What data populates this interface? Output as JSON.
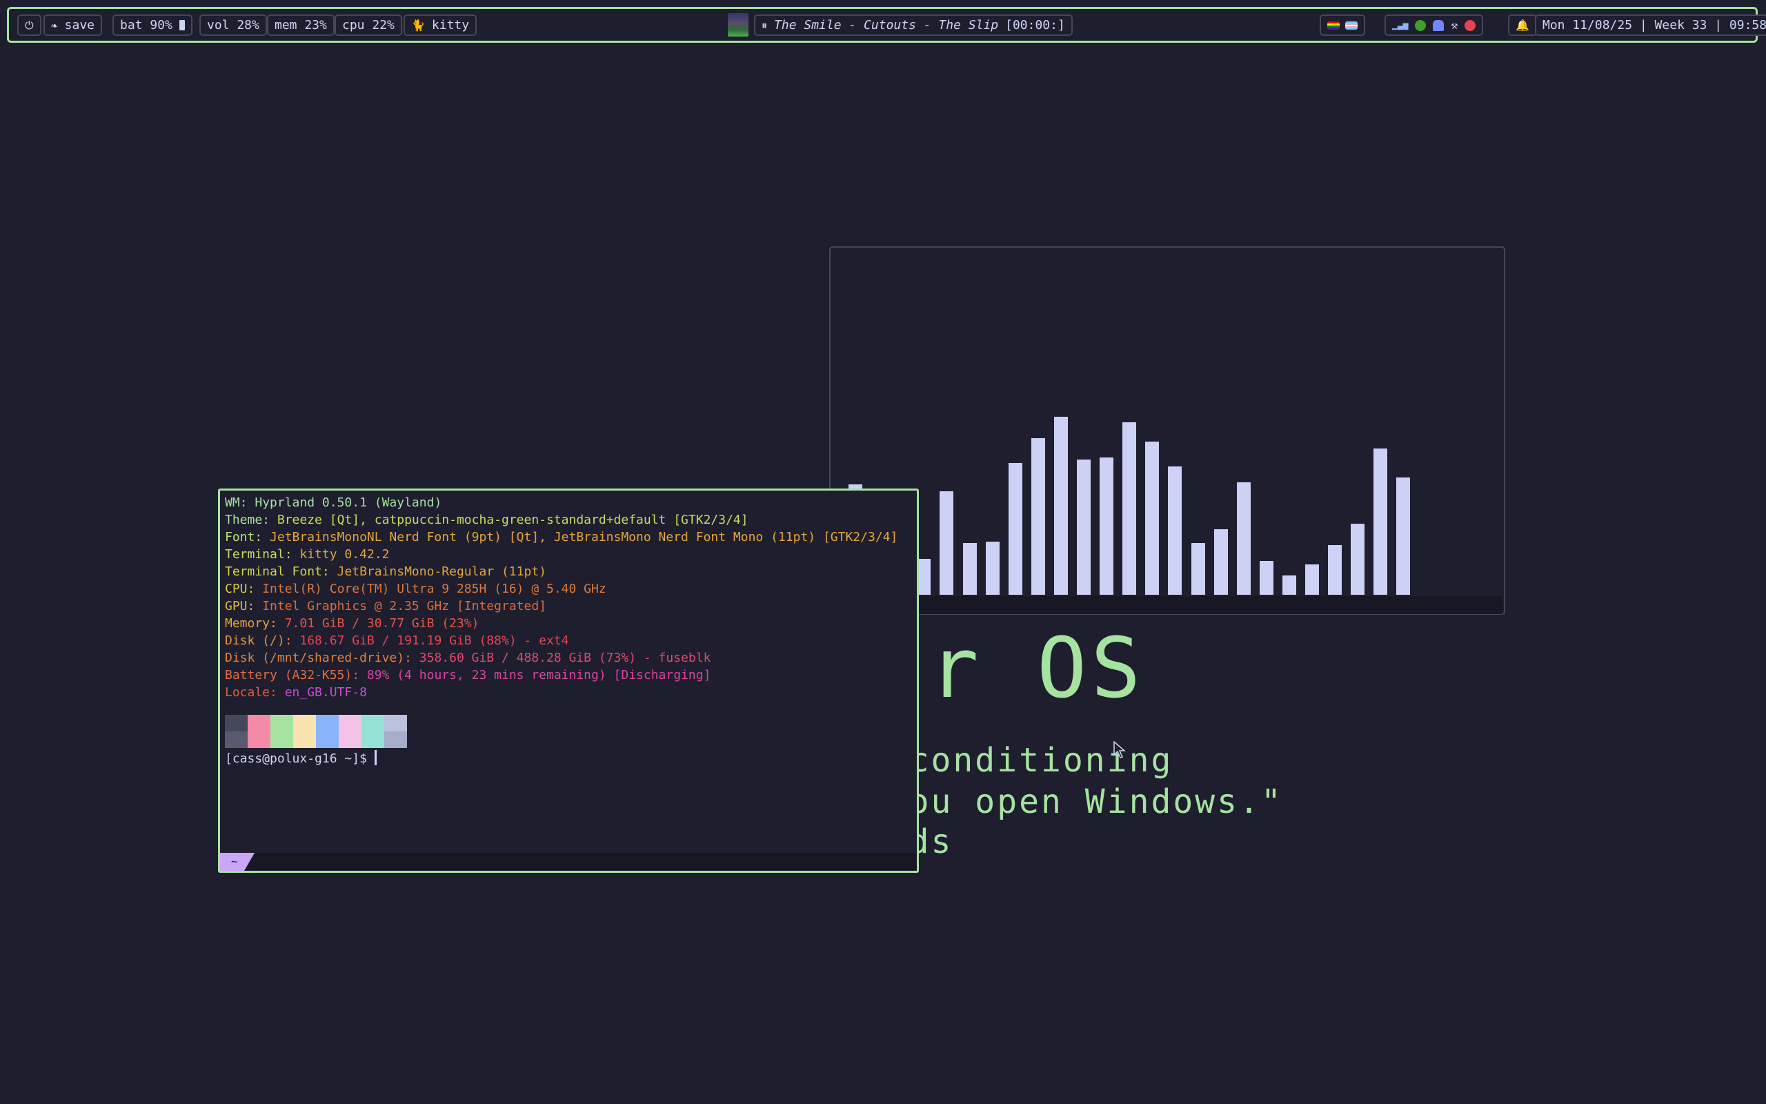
{
  "topbar": {
    "power_icon": "power-icon",
    "save_label": "save",
    "battery_label": "bat 90%",
    "volume_label": "vol 28%",
    "memory_label": "mem 23%",
    "cpu_label": "cpu 22%",
    "active_window_label": "kitty",
    "media": {
      "title": "The Smile - Cutouts - The Slip",
      "time": "[00:00:]"
    },
    "datetime": "Mon 11/08/25 | Week 33 | 09:58"
  },
  "visualizer": {
    "bar_levels": [
      0.62,
      0.28,
      0.16,
      0.2,
      0.58,
      0.29,
      0.3,
      0.74,
      0.88,
      1.0,
      0.76,
      0.77,
      0.97,
      0.86,
      0.72,
      0.29,
      0.37,
      0.63,
      0.19,
      0.11,
      0.17,
      0.28,
      0.4,
      0.82,
      0.66
    ]
  },
  "quote": {
    "title": "our OS",
    "line1": "air conditioning",
    "line2": "en you open Windows.\"",
    "line3": "rvalds"
  },
  "terminal": {
    "lines": [
      {
        "key": "WM:",
        "value": " Hyprland 0.50.1 (Wayland)",
        "color": "#a6e3a1"
      },
      {
        "key": "Theme:",
        "value": " Breeze [Qt], catppuccin-mocha-green-standard+default [GTK2/3/4]",
        "color": "#c6dc62"
      },
      {
        "key": "Font:",
        "value": " JetBrainsMonoNL Nerd Font (9pt) [Qt], JetBrainsMono Nerd Font Mono (11pt) [GTK2/3/4]",
        "color": "#e3a63b"
      },
      {
        "key": "Terminal:",
        "value": " kitty 0.42.2",
        "color": "#e3a63b"
      },
      {
        "key": "Terminal Font:",
        "value": " JetBrainsMono-Regular (11pt)",
        "color": "#e3a63b"
      },
      {
        "key": "CPU:",
        "value": " Intel(R) Core(TM) Ultra 9 285H (16) @ 5.40 GHz",
        "color": "#e3a63b"
      },
      {
        "key": "GPU:",
        "value": " Intel Graphics @ 2.35 GHz [Integrated]",
        "color": "#e3a63b"
      },
      {
        "key": "Memory:",
        "value": " 7.01 GiB / 30.77 GiB (23%)",
        "color": "#e3a63b"
      },
      {
        "key": "Disk (/):",
        "value": " 168.67 GiB / 191.19 GiB (88%) - ext4",
        "color": "#e3a63b"
      },
      {
        "key": "Disk (/mnt/shared-drive):",
        "value": " 358.60 GiB / 488.28 GiB (73%) - fuseblk",
        "color": "#e3a63b"
      },
      {
        "key": "Battery (A32-K55):",
        "value": " 89% (4 hours, 23 mins remaining) [Discharging]",
        "color": "#e3a63b"
      },
      {
        "key": "Locale:",
        "value": " en_GB.UTF-8",
        "color": "#e3a63b"
      }
    ],
    "palette": [
      [
        "#45475a",
        "#585b70"
      ],
      [
        "#f38ba8",
        "#f38ba8"
      ],
      [
        "#a6e3a1",
        "#a6e3a1"
      ],
      [
        "#f9e2af",
        "#f9e2af"
      ],
      [
        "#89b4fa",
        "#89b4fa"
      ],
      [
        "#f5c2e7",
        "#f5c2e7"
      ],
      [
        "#94e2d5",
        "#94e2d5"
      ],
      [
        "#bac2de",
        "#a6adc8"
      ]
    ],
    "prompt": "[cass@polux-g16 ~]$ ",
    "tab_label": "~"
  },
  "colors": {
    "accent": "#a6e3a1",
    "background": "#1e1e2e",
    "text": "#cdd6f4"
  }
}
